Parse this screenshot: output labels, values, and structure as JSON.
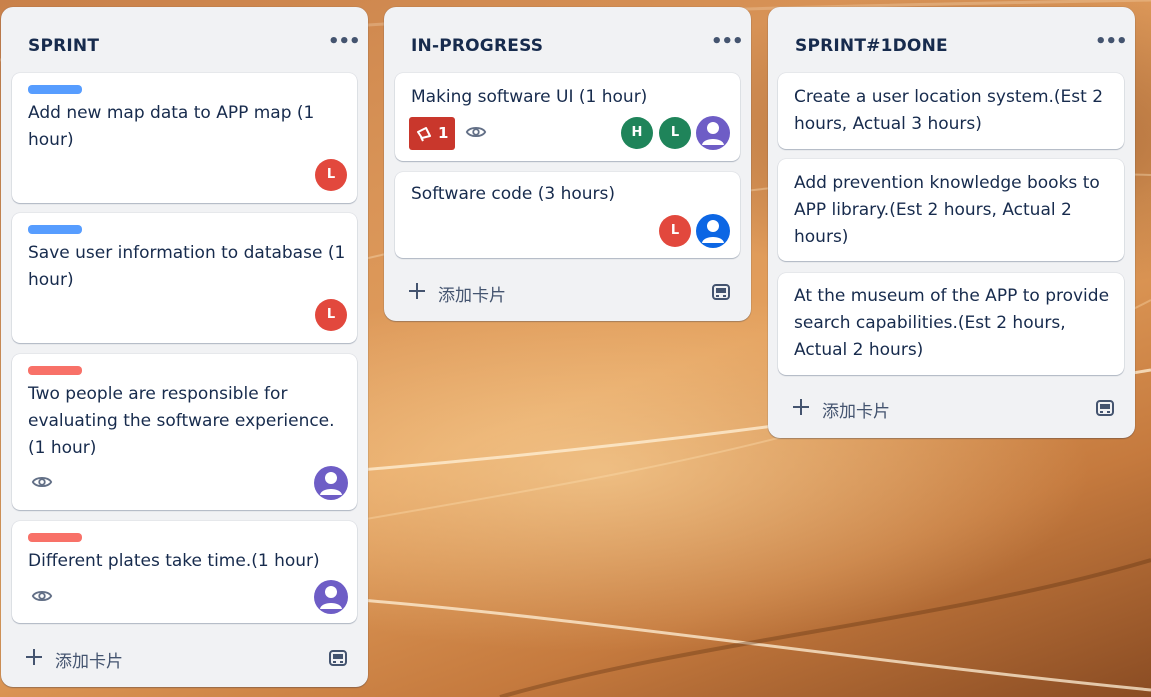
{
  "colors": {
    "label_blue": "#579dff",
    "label_red": "#f87168",
    "avatar_l": "#e2483d",
    "avatar_h": "#1f845a",
    "avatar_person_purple": "#6e5dc6",
    "avatar_person_blue": "#0c66e4",
    "badge_red": "#c9372c"
  },
  "lists": [
    {
      "title": "SPRINT",
      "menu": "•••",
      "add_card": "添加卡片",
      "cards": [
        {
          "label_color": "blue",
          "title": "Add new map data to APP map (1 hour)",
          "members": [
            "L"
          ]
        },
        {
          "label_color": "blue",
          "title": "Save user information to database (1 hour)",
          "members": [
            "L"
          ]
        },
        {
          "label_color": "red",
          "title": "Two people are responsible for evaluating the software experience.(1 hour)",
          "watching": true,
          "members": [
            "person"
          ]
        },
        {
          "label_color": "red",
          "title": "Different plates take time.(1 hour)",
          "watching": true,
          "members": [
            "person"
          ]
        }
      ]
    },
    {
      "title": "IN-PROGRESS",
      "menu": "•••",
      "add_card": "添加卡片",
      "cards": [
        {
          "title": "Making software UI  (1 hour)",
          "badge_count": "1",
          "watching": true,
          "members": [
            "H",
            "L",
            "person"
          ]
        },
        {
          "title": "Software code  (3 hours)",
          "members": [
            "L",
            "person"
          ]
        }
      ]
    },
    {
      "title": "SPRINT#1DONE",
      "menu": "•••",
      "add_card": "添加卡片",
      "cards": [
        {
          "title": "Create a user location system.(Est 2 hours, Actual 3 hours)"
        },
        {
          "title": "Add prevention knowledge books to APP library.(Est 2 hours, Actual 2 hours)"
        },
        {
          "title": "At the museum of the APP to provide search capabilities.(Est 2 hours, Actual 2 hours)"
        }
      ]
    }
  ],
  "icons": [
    "dots-menu-icon",
    "eye-icon",
    "plus-icon",
    "card-template-icon",
    "megaphone-icon",
    "user-icon"
  ]
}
